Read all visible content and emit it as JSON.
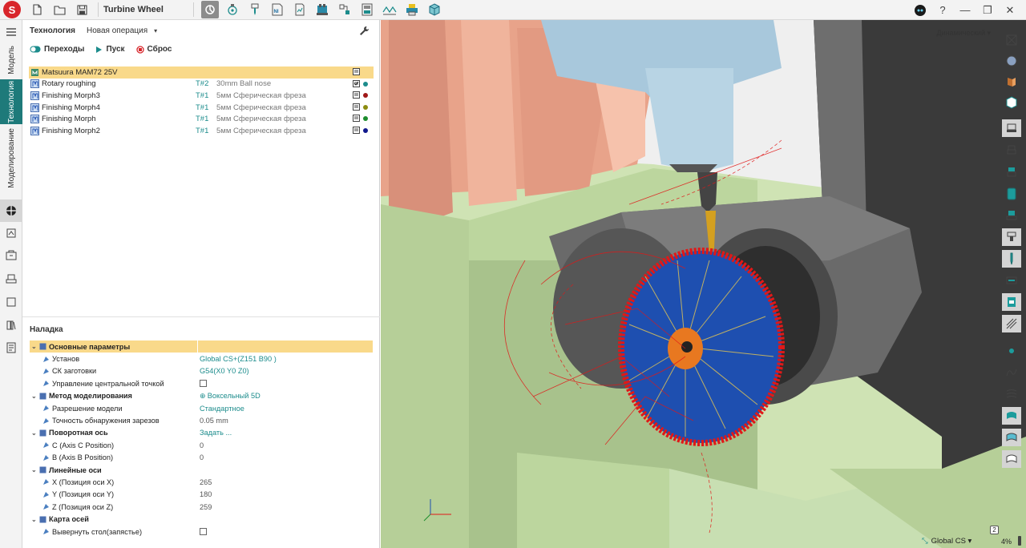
{
  "app": {
    "document_title": "Turbine Wheel",
    "toolbar_icons": [
      "new-file-icon",
      "open-folder-icon",
      "save-icon",
      "machine-setup-icon",
      "tool-icon",
      "spindle-icon",
      "nc-icon",
      "report-icon",
      "fixture-icon",
      "tool-library-icon",
      "simulation-icon",
      "toolpath-icon",
      "printer-icon",
      "cube-icon"
    ],
    "window": {
      "help": "?",
      "minimize": "—",
      "restore": "❐",
      "close": "✕"
    }
  },
  "left_tabs": {
    "model": "Модель",
    "technology": "Технология",
    "modeling": "Моделирование"
  },
  "panel": {
    "header_title": "Технология",
    "new_operation": "Новая операция",
    "actions": {
      "transitions": "Переходы",
      "start": "Пуск",
      "reset": "Сброс"
    },
    "operations": [
      {
        "name": "Matsuura MAM72 25V",
        "tool": "",
        "description": "",
        "highlight": true,
        "dot": ""
      },
      {
        "name": "Rotary roughing",
        "tool": "T#2",
        "description": "30mm Ball nose",
        "highlight": false,
        "dot": "#1c8c8c"
      },
      {
        "name": "Finishing Morph3",
        "tool": "T#1",
        "description": "5мм Сферическая фреза",
        "highlight": false,
        "dot": "#a01818"
      },
      {
        "name": "Finishing Morph4",
        "tool": "T#1",
        "description": "5мм Сферическая фреза",
        "highlight": false,
        "dot": "#8c8c10"
      },
      {
        "name": "Finishing Morph",
        "tool": "T#1",
        "description": "5мм Сферическая фреза",
        "highlight": false,
        "dot": "#1c8c2c"
      },
      {
        "name": "Finishing Morph2",
        "tool": "T#1",
        "description": "5мм Сферическая фреза",
        "highlight": false,
        "dot": "#10188c"
      }
    ],
    "setup_title": "Наладка",
    "properties": [
      {
        "label": "Основные параметры",
        "value": "",
        "group": true,
        "level": 0,
        "highlight": true,
        "link": false,
        "checkbox": false
      },
      {
        "label": "Установ",
        "value": "Global CS+(Z151 B90 )",
        "group": false,
        "level": 1,
        "highlight": false,
        "link": true,
        "checkbox": false
      },
      {
        "label": "СК заготовки",
        "value": "G54(X0 Y0 Z0)",
        "group": false,
        "level": 1,
        "highlight": false,
        "link": true,
        "checkbox": false
      },
      {
        "label": "Управление центральной точкой",
        "value": "",
        "group": false,
        "level": 1,
        "highlight": false,
        "link": false,
        "checkbox": true
      },
      {
        "label": "Метод моделирования",
        "value": "Воксельный 5D",
        "group": true,
        "level": 0,
        "highlight": false,
        "link": true,
        "checkbox": false
      },
      {
        "label": "Разрешение модели",
        "value": "Стандартное",
        "group": false,
        "level": 1,
        "highlight": false,
        "link": true,
        "checkbox": false
      },
      {
        "label": "Точность обнаружения зарезов",
        "value": "0.05 mm",
        "group": false,
        "level": 1,
        "highlight": false,
        "link": false,
        "checkbox": false
      },
      {
        "label": "Поворотная ось",
        "value": "Задать ...",
        "group": true,
        "level": 0,
        "highlight": false,
        "link": true,
        "checkbox": false
      },
      {
        "label": "C (Axis C Position)",
        "value": "0",
        "group": false,
        "level": 1,
        "highlight": false,
        "link": false,
        "checkbox": false
      },
      {
        "label": "B (Axis B Position)",
        "value": "0",
        "group": false,
        "level": 1,
        "highlight": false,
        "link": false,
        "checkbox": false
      },
      {
        "label": "Линейные оси",
        "value": "",
        "group": true,
        "level": 0,
        "highlight": false,
        "link": false,
        "checkbox": false
      },
      {
        "label": "X (Позиция оси X)",
        "value": "265",
        "group": false,
        "level": 1,
        "highlight": false,
        "link": false,
        "checkbox": false
      },
      {
        "label": "Y (Позиция оси Y)",
        "value": "180",
        "group": false,
        "level": 1,
        "highlight": false,
        "link": false,
        "checkbox": false
      },
      {
        "label": "Z (Позиция оси Z)",
        "value": "259",
        "group": false,
        "level": 1,
        "highlight": false,
        "link": false,
        "checkbox": false
      },
      {
        "label": "Карта осей",
        "value": "",
        "group": true,
        "level": 0,
        "highlight": false,
        "link": false,
        "checkbox": false
      },
      {
        "label": "Вывернуть стол(запястье)",
        "value": "",
        "group": false,
        "level": 1,
        "highlight": false,
        "link": false,
        "checkbox": true
      }
    ]
  },
  "viewport": {
    "view_mode": "Динамический",
    "coordinate_system": "Global CS",
    "zoom": "4%",
    "badge": "2",
    "colors": {
      "part_orange": "#e8a38a",
      "fixture_green": "#c5dba9",
      "chuck_dark": "#5e5e5e",
      "spindle_blue": "#a8c8dc",
      "toolpath_red": "#e01818",
      "toolpath_blue": "#1e4fb0"
    }
  }
}
